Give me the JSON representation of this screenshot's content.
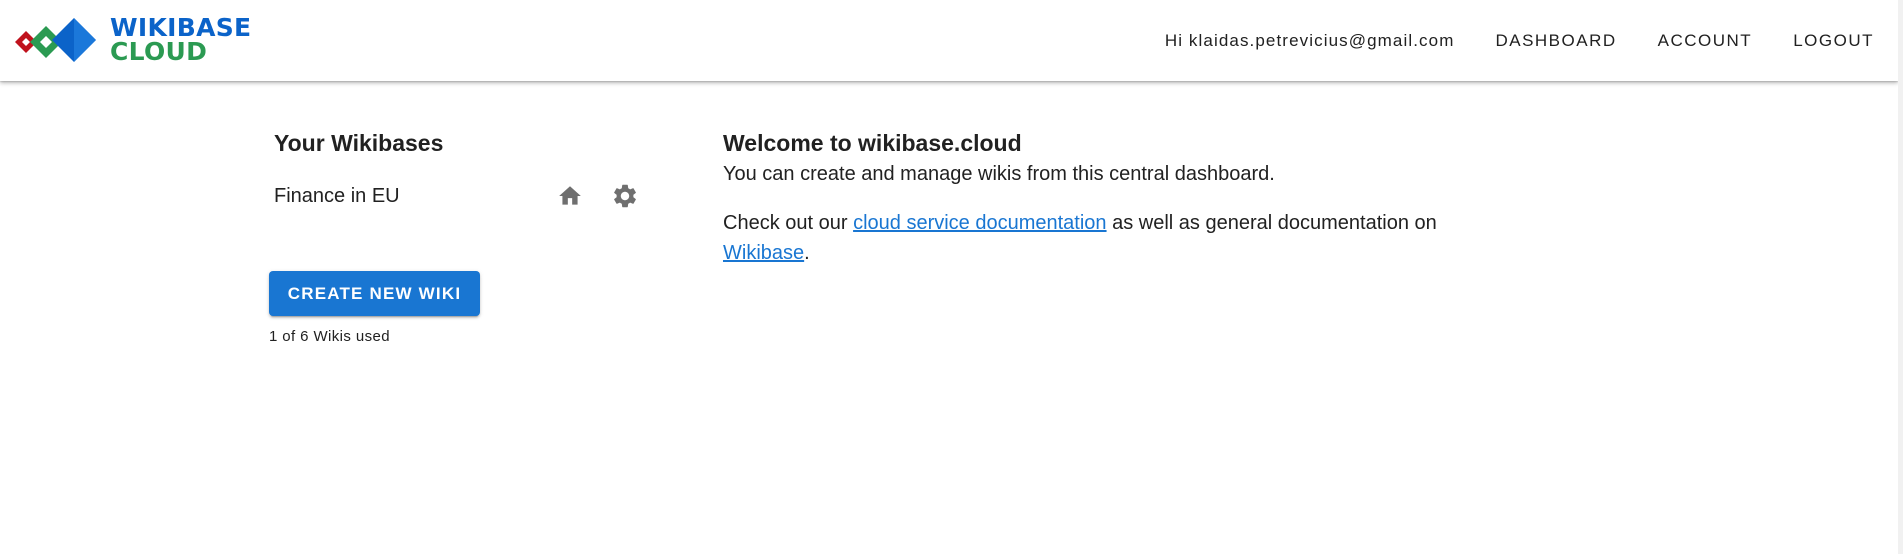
{
  "brand": {
    "line1": "WIKIBASE",
    "line2": "CLOUD",
    "colors": {
      "blue": "#0b63c9",
      "green": "#2b9a52",
      "red": "#c0121d"
    }
  },
  "nav": {
    "greeting": "Hi klaidas.petrevicius@gmail.com",
    "items": [
      "DASHBOARD",
      "ACCOUNT",
      "LOGOUT"
    ]
  },
  "wikis": {
    "title": "Your Wikibases",
    "list": [
      {
        "name": "Finance in EU",
        "icons": [
          "home-icon",
          "settings-icon"
        ]
      }
    ],
    "create_label": "CREATE NEW WIKI",
    "usage": "1 of 6 Wikis used"
  },
  "welcome": {
    "title": "Welcome to wikibase.cloud",
    "subtitle": "You can create and manage wikis from this central dashboard.",
    "para_prefix": "Check out our ",
    "link1": "cloud service documentation",
    "para_middle": " as well as general documentation on ",
    "link2": "Wikibase",
    "para_suffix": "."
  },
  "colors": {
    "primary": "#1976d2",
    "icon_grey": "#6f6f6f",
    "text": "#212121"
  }
}
